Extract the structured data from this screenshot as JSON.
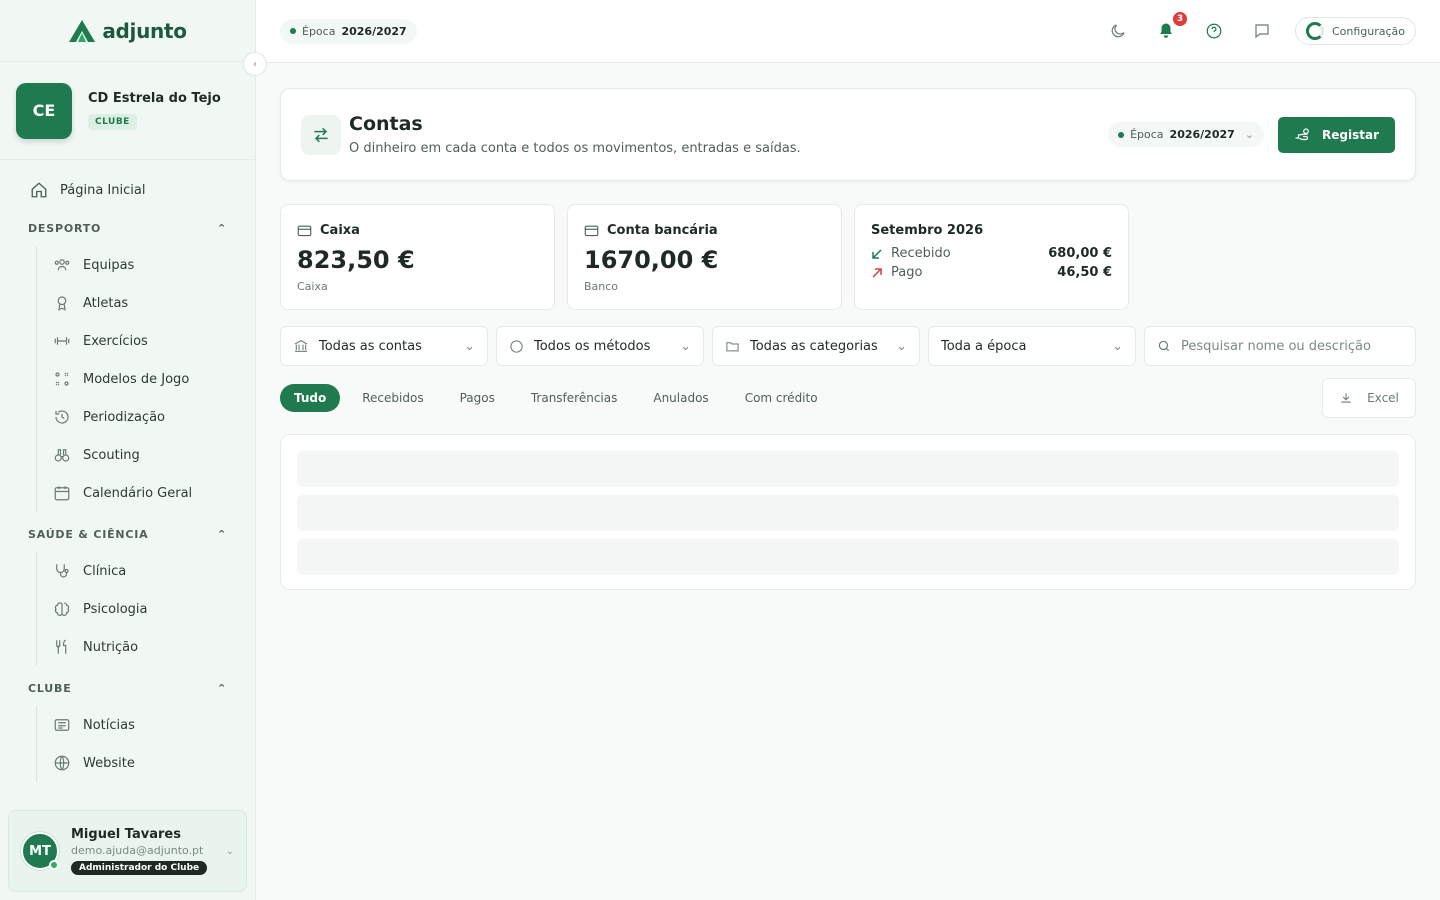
{
  "app": {
    "name": "adjunto"
  },
  "club": {
    "initials": "CE",
    "name": "CD Estrela do Tejo",
    "badge": "CLUBE"
  },
  "nav": {
    "home": "Página Inicial",
    "sections": [
      {
        "title": "DESPORTO",
        "items": [
          "Equipas",
          "Atletas",
          "Exercícios",
          "Modelos de Jogo",
          "Periodização",
          "Scouting",
          "Calendário Geral"
        ]
      },
      {
        "title": "SAÚDE & CIÊNCIA",
        "items": [
          "Clínica",
          "Psicologia",
          "Nutrição"
        ]
      },
      {
        "title": "CLUBE",
        "items": [
          "Notícias",
          "Website"
        ]
      }
    ]
  },
  "user": {
    "initials": "MT",
    "name": "Miguel Tavares",
    "email": "demo.ajuda@adjunto.pt",
    "role": "Administrador do Clube"
  },
  "topbar": {
    "season_label": "Época",
    "season_value": "2026/2027",
    "notifications": "3",
    "config_label": "Configuração"
  },
  "page": {
    "title": "Contas",
    "subtitle": "O dinheiro em cada conta e todos os movimentos, entradas e saídas.",
    "season_label": "Época",
    "season_value": "2026/2027",
    "register_label": "Registar"
  },
  "stats": {
    "cash": {
      "title": "Caixa",
      "value": "823,50 €",
      "sub": "Caixa"
    },
    "bank": {
      "title": "Conta bancária",
      "value": "1670,00 €",
      "sub": "Banco"
    },
    "month": {
      "title": "Setembro 2026",
      "received_label": "Recebido",
      "received_value": "680,00 €",
      "paid_label": "Pago",
      "paid_value": "46,50 €"
    }
  },
  "filters": {
    "accounts": "Todas as contas",
    "methods": "Todos os métodos",
    "categories": "Todas as categorias",
    "period": "Toda a época",
    "search_placeholder": "Pesquisar nome ou descrição"
  },
  "tabs": [
    "Tudo",
    "Recebidos",
    "Pagos",
    "Transferências",
    "Anulados",
    "Com crédito"
  ],
  "export_label": "Excel",
  "colors": {
    "brand": "#1f7a4f",
    "badge": "#e03b3b",
    "sidebar": "#f1f8f4"
  }
}
